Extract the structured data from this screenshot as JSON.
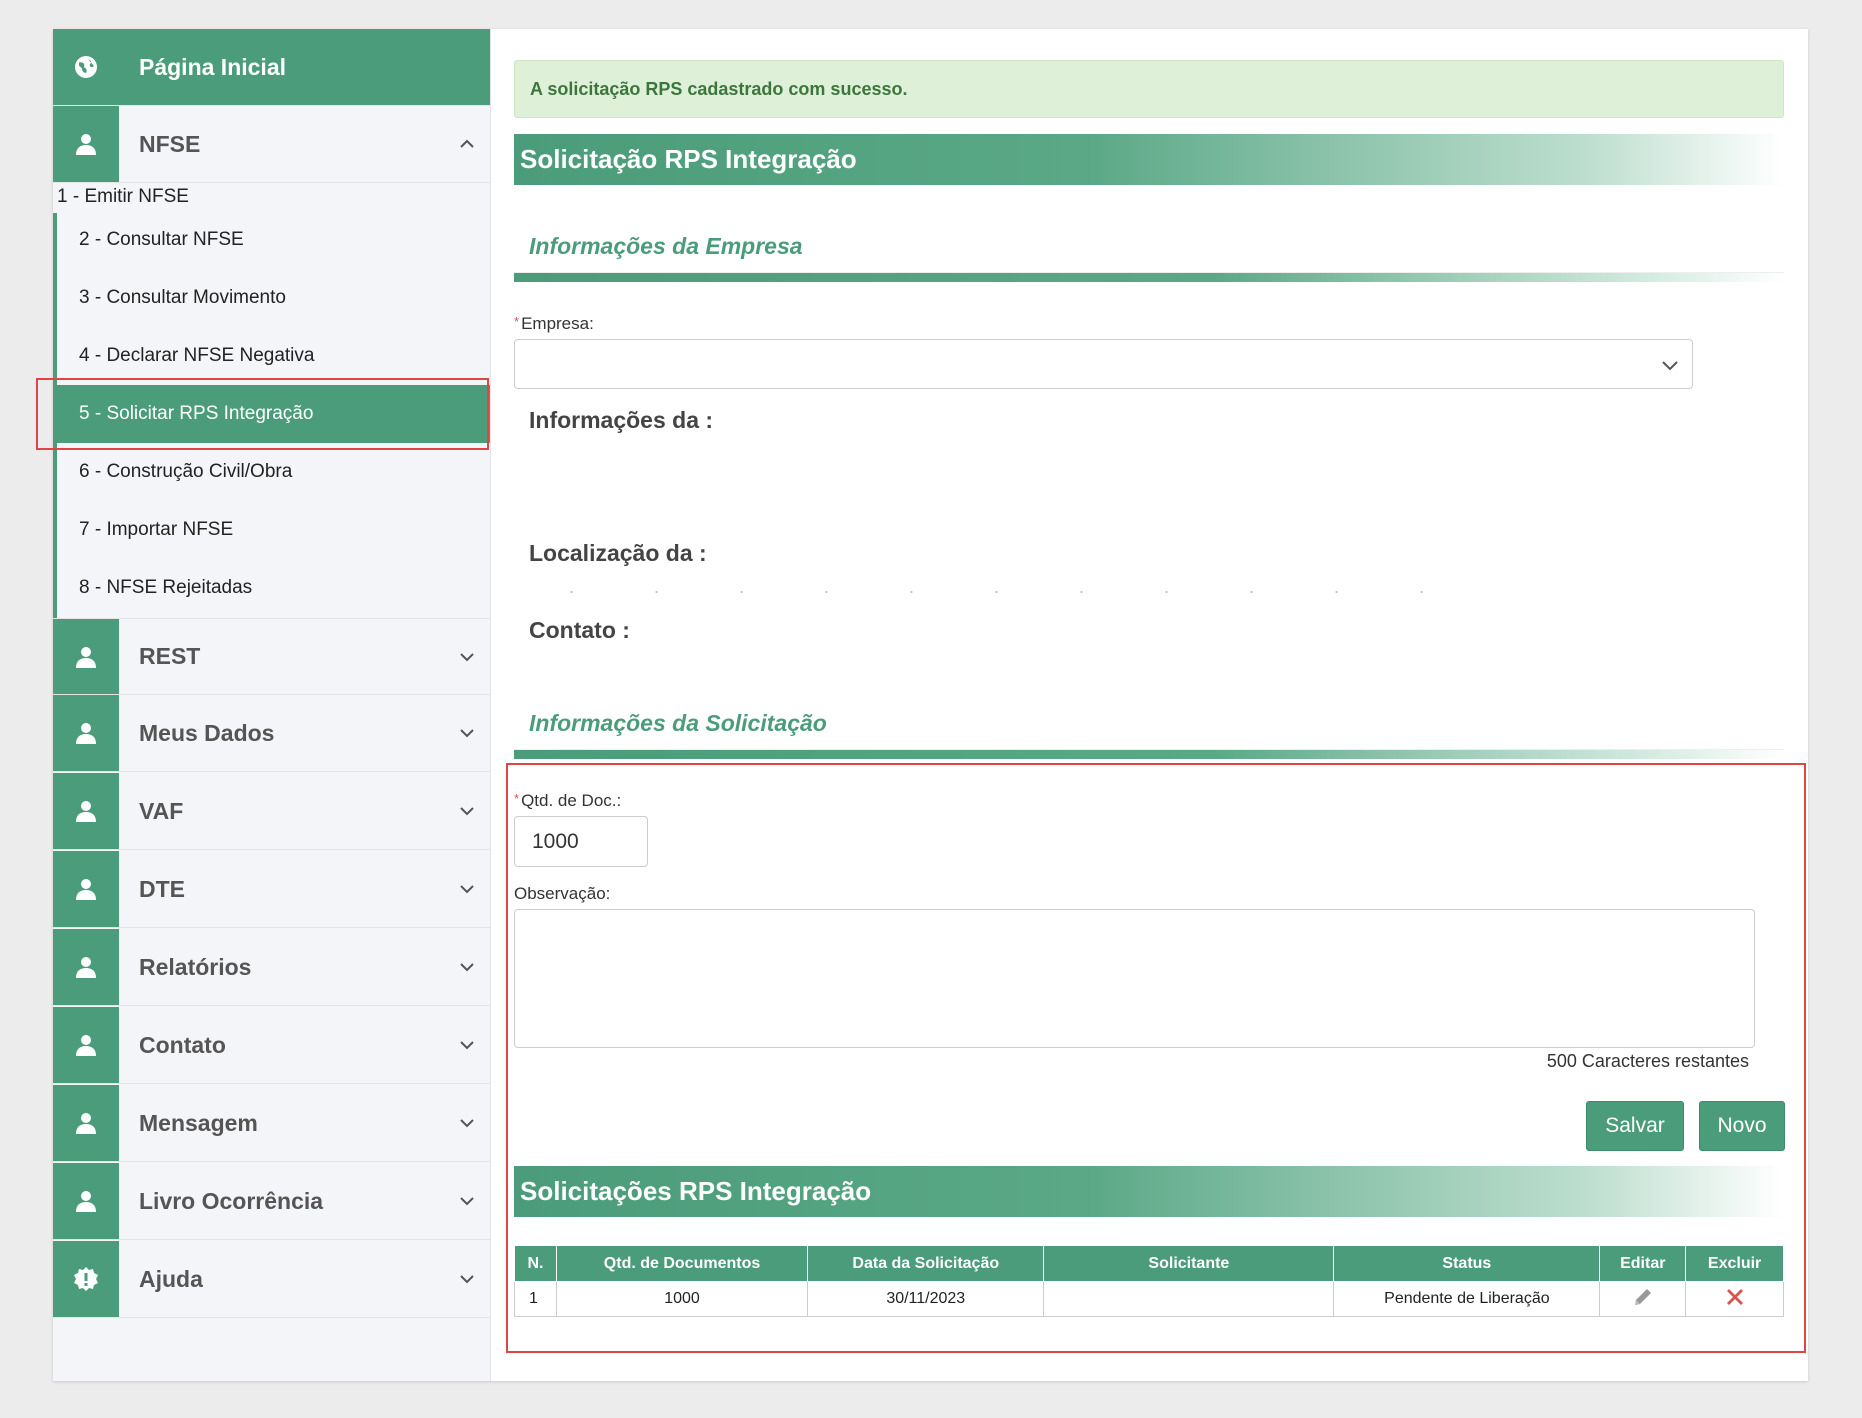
{
  "sidebar": {
    "home_label": "Página Inicial",
    "nfse_label": "NFSE",
    "nfse_items": [
      "1 - Emitir NFSE",
      "2 - Consultar NFSE",
      "3 - Consultar Movimento",
      "4 - Declarar NFSE Negativa",
      "5 - Solicitar RPS Integração",
      "6 - Construção Civil/Obra",
      "7 - Importar NFSE",
      "8 - NFSE Rejeitadas"
    ],
    "active_item": "5 - Solicitar RPS Integração",
    "menus": [
      "REST",
      "Meus Dados",
      "VAF",
      "DTE",
      "Relatórios",
      "Contato",
      "Mensagem",
      "Livro Ocorrência",
      "Ajuda"
    ]
  },
  "main": {
    "alert": "A solicitação RPS cadastrado com sucesso.",
    "page_title": "Solicitação RPS Integração",
    "empresa_section_title": "Informações da Empresa",
    "empresa_label": "Empresa:",
    "empresa_value": "",
    "info_label": "Informações da :",
    "localizacao_label": "Localização da :",
    "contato_label": "Contato :",
    "solicitacao_section_title": "Informações da Solicitação",
    "qtd_label": "Qtd. de Doc.:",
    "qtd_value": "1000",
    "observacao_label": "Observação:",
    "observacao_value": "",
    "chars_remaining": "500 Caracteres restantes",
    "save_label": "Salvar",
    "new_label": "Novo",
    "list_title": "Solicitações RPS Integração",
    "table": {
      "headers": [
        "N.",
        "Qtd. de Documentos",
        "Data da Solicitação",
        "Solicitante",
        "Status",
        "Editar",
        "Excluir"
      ],
      "rows": [
        {
          "n": "1",
          "qtd": "1000",
          "data": "30/11/2023",
          "solicitante": "",
          "status": "Pendente de Liberação",
          "edit_icon": "pencil-icon",
          "delete_icon": "delete-x-icon"
        }
      ]
    }
  },
  "colors": {
    "primary": "#4b9c7a",
    "alert_bg": "#dff0d8",
    "alert_text": "#3c763d",
    "highlight_border": "#e04444",
    "delete": "#d9534f"
  }
}
